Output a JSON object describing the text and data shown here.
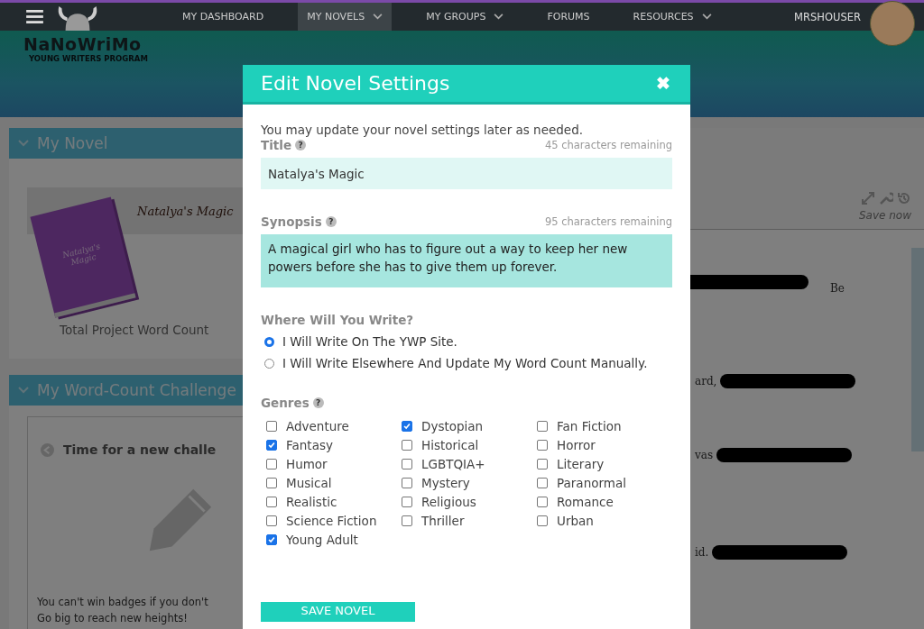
{
  "nav": {
    "items": [
      {
        "label": "MY DASHBOARD",
        "selected": false,
        "dropdown": false
      },
      {
        "label": "MY NOVELS",
        "selected": true,
        "dropdown": true
      },
      {
        "label": "MY GROUPS",
        "selected": false,
        "dropdown": true
      },
      {
        "label": "FORUMS",
        "selected": false,
        "dropdown": false
      },
      {
        "label": "RESOURCES",
        "selected": false,
        "dropdown": true
      }
    ],
    "username": "MRSHOUSER"
  },
  "logo": {
    "name": "NaNoWriMo",
    "subtitle": "YOUNG WRITERS PROGRAM"
  },
  "my_novel": {
    "heading": "My Novel",
    "cover_title": "Natalya's Magic",
    "title": "Natalya's Magic",
    "word_count_label": "Total Project Word Count"
  },
  "challenge": {
    "heading": "My Word-Count Challenge",
    "title": "Time for a new challe",
    "lines": [
      "You can't win badges if you don't",
      "Go big to reach new heights!"
    ]
  },
  "editor": {
    "save_label": "Save now",
    "fragments": [
      "Be",
      "ard,",
      "vas",
      "id."
    ]
  },
  "modal": {
    "title": "Edit Novel Settings",
    "close_glyph": "✖",
    "help_glyph": "?",
    "intro": "You may update your novel settings later as needed.",
    "title_field": {
      "label": "Title",
      "remaining": "45 characters remaining",
      "value": "Natalya's Magic"
    },
    "synopsis_field": {
      "label": "Synopsis",
      "remaining": "95 characters remaining",
      "value": "A magical girl who has to figure out a way to keep her new powers before she has to give them up forever."
    },
    "where": {
      "label": "Where Will You Write?",
      "options": [
        {
          "label": "I Will Write On The YWP Site.",
          "selected": true
        },
        {
          "label": "I Will Write Elsewhere And Update My Word Count Manually.",
          "selected": false
        }
      ]
    },
    "genres": {
      "label": "Genres",
      "items": [
        {
          "label": "Adventure",
          "checked": false
        },
        {
          "label": "Dystopian",
          "checked": true
        },
        {
          "label": "Fan Fiction",
          "checked": false
        },
        {
          "label": "Fantasy",
          "checked": true
        },
        {
          "label": "Historical",
          "checked": false
        },
        {
          "label": "Horror",
          "checked": false
        },
        {
          "label": "Humor",
          "checked": false
        },
        {
          "label": "LGBTQIA+",
          "checked": false
        },
        {
          "label": "Literary",
          "checked": false
        },
        {
          "label": "Musical",
          "checked": false
        },
        {
          "label": "Mystery",
          "checked": false
        },
        {
          "label": "Paranormal",
          "checked": false
        },
        {
          "label": "Realistic",
          "checked": false
        },
        {
          "label": "Religious",
          "checked": false
        },
        {
          "label": "Romance",
          "checked": false
        },
        {
          "label": "Science Fiction",
          "checked": false
        },
        {
          "label": "Thriller",
          "checked": false
        },
        {
          "label": "Urban",
          "checked": false
        },
        {
          "label": "Young Adult",
          "checked": true
        }
      ]
    },
    "save_button": "SAVE NOVEL"
  }
}
